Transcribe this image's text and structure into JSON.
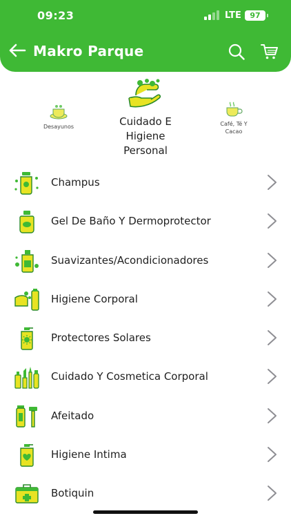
{
  "status_bar": {
    "time": "09:23",
    "network": "LTE",
    "battery": "97"
  },
  "nav": {
    "title": "Makro Parque"
  },
  "categories": {
    "left": {
      "label": "Desayunos",
      "icon": "breakfast-icon"
    },
    "center": {
      "label_lines": [
        "Cuidado E",
        "Higiene",
        "Personal"
      ],
      "icon": "hand-washing-icon"
    },
    "right": {
      "label_lines": [
        "Café, Té Y",
        "Cacao"
      ],
      "icon": "coffee-cup-icon"
    }
  },
  "items": [
    {
      "label": "Champus",
      "icon": "shampoo-icon"
    },
    {
      "label": "Gel De Baño Y Dermoprotector",
      "icon": "shower-gel-icon"
    },
    {
      "label": "Suavizantes/Acondicionadores",
      "icon": "conditioner-icon"
    },
    {
      "label": "Higiene Corporal",
      "icon": "body-hygiene-icon"
    },
    {
      "label": "Protectores Solares",
      "icon": "sunscreen-icon"
    },
    {
      "label": "Cuidado Y Cosmetica Corporal",
      "icon": "cosmetics-icon"
    },
    {
      "label": "Afeitado",
      "icon": "razor-icon"
    },
    {
      "label": "Higiene Intima",
      "icon": "intimate-hygiene-icon"
    },
    {
      "label": "Botiquin",
      "icon": "first-aid-kit-icon"
    }
  ],
  "colors": {
    "brand_green": "#3fb935",
    "icon_yellow": "#e8e323",
    "icon_stroke": "#2a8a2a"
  }
}
